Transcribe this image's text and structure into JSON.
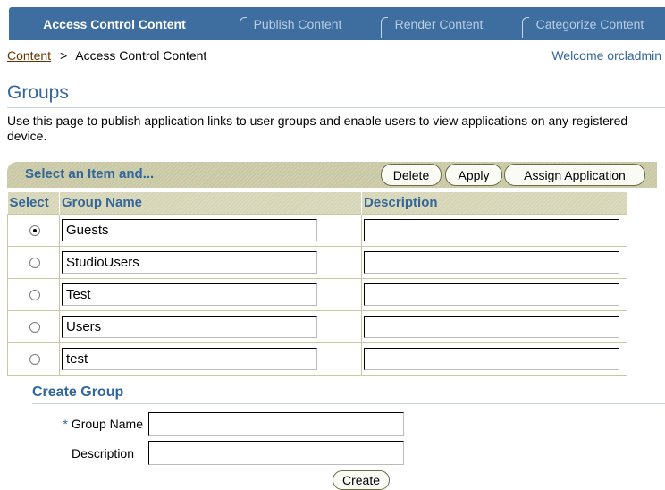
{
  "tabs": [
    {
      "label": "Access Control Content",
      "active": true
    },
    {
      "label": "Publish Content",
      "active": false
    },
    {
      "label": "Render Content",
      "active": false
    },
    {
      "label": "Categorize Content",
      "active": false
    }
  ],
  "breadcrumb": {
    "link": "Content",
    "separator": ">",
    "current": "Access Control Content"
  },
  "welcome": "Welcome orcladmin",
  "page_title": "Groups",
  "intro": "Use this page to publish application links to user groups and enable users to view applications on any registered device.",
  "actionbar": {
    "label": "Select an Item and...",
    "buttons": {
      "delete": "Delete",
      "apply": "Apply",
      "assign": "Assign Application"
    }
  },
  "table": {
    "headers": {
      "select": "Select",
      "group_name": "Group Name",
      "description": "Description"
    },
    "rows": [
      {
        "selected": true,
        "group_name": "Guests",
        "description": ""
      },
      {
        "selected": false,
        "group_name": "StudioUsers",
        "description": ""
      },
      {
        "selected": false,
        "group_name": "Test",
        "description": ""
      },
      {
        "selected": false,
        "group_name": "Users",
        "description": ""
      },
      {
        "selected": false,
        "group_name": "test",
        "description": ""
      }
    ]
  },
  "create_group": {
    "title": "Create Group",
    "required_marker": "*",
    "group_name_label": "Group Name",
    "description_label": "Description",
    "group_name_value": "",
    "description_value": "",
    "create_button": "Create"
  },
  "colors": {
    "tab_bar": "#3e6ea0",
    "heading_blue": "#336699",
    "action_bar": "#c9c8a4",
    "breadcrumb_link": "#663300"
  }
}
